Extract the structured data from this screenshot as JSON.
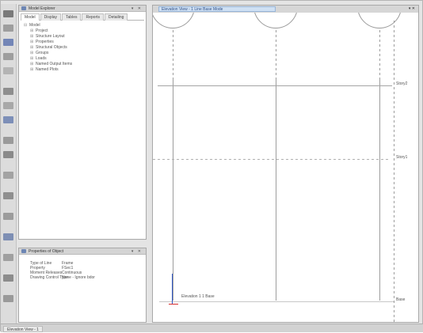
{
  "explorer": {
    "title": "Model Explorer",
    "controls": "▾ ✕",
    "tabs": [
      "Model",
      "Display",
      "Tables",
      "Reports",
      "Detailing"
    ],
    "root": "Model",
    "items": [
      "Project",
      "Structure Layout",
      "Properties",
      "Structural Objects",
      "Groups",
      "Loads",
      "Named Output Items",
      "Named Plots"
    ]
  },
  "properties": {
    "title": "Properties of Object",
    "controls": "▾ ✕",
    "rows": [
      {
        "key": "Type of Line",
        "value": "Frame"
      },
      {
        "key": "Property",
        "value": "FSec1"
      },
      {
        "key": "Moment Releases",
        "value": "Continuous"
      },
      {
        "key": "Drawing Control Type",
        "value": "None - Ignore bdor"
      }
    ]
  },
  "view": {
    "tab_title": "Elevation View - 1 Line Base Mode",
    "controls": "▾ ✕",
    "stories": [
      "Story2",
      "Story1",
      "Base"
    ],
    "axis_label": "Elevation 1   1   Base"
  },
  "status": {
    "tab": "Elevation View - 1"
  },
  "colors": {
    "axis_x": "#d52b2b",
    "axis_y": "#2f58c8",
    "accent": "#2d4f88"
  }
}
